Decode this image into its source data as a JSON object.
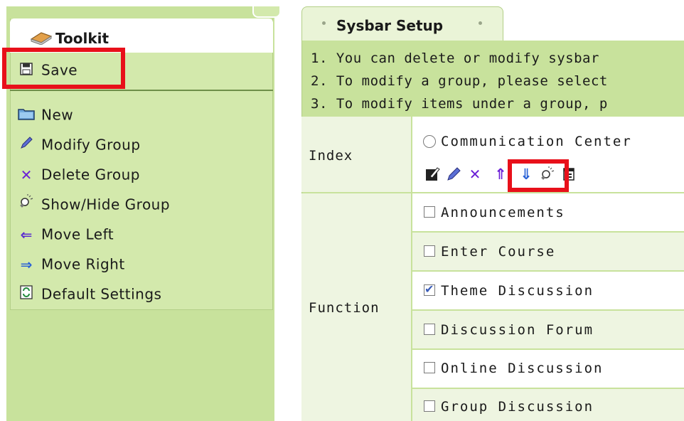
{
  "toolkit": {
    "title": "Toolkit",
    "items": [
      {
        "label": "Save",
        "icon": "floppy-disk-icon"
      },
      {
        "label": "New",
        "icon": "folder-icon"
      },
      {
        "label": "Modify Group",
        "icon": "pencil-icon"
      },
      {
        "label": "Delete Group",
        "icon": "delete-x-icon"
      },
      {
        "label": "Show/Hide Group",
        "icon": "lightbulb-icon"
      },
      {
        "label": "Move Left",
        "icon": "arrow-left-icon"
      },
      {
        "label": "Move Right",
        "icon": "arrow-right-icon"
      },
      {
        "label": "Default Settings",
        "icon": "refresh-icon"
      }
    ]
  },
  "setup": {
    "tab_title": "Sysbar Setup",
    "instructions": [
      "1. You can delete or modify sysbar",
      "2. To modify a group, please select",
      "3. To modify items under a group, p"
    ],
    "index_label": "Index",
    "group_name": "Communication Center",
    "function_label": "Function",
    "functions": [
      {
        "label": "Announcements",
        "checked": false
      },
      {
        "label": "Enter Course",
        "checked": false
      },
      {
        "label": "Theme Discussion",
        "checked": true
      },
      {
        "label": "Discussion Forum",
        "checked": false
      },
      {
        "label": "Online Discussion",
        "checked": false
      },
      {
        "label": "Group Discussion",
        "checked": false
      }
    ],
    "group_icons": [
      "edit-icon",
      "pencil-icon",
      "delete-x-icon",
      "arrow-up-icon",
      "arrow-down-icon",
      "lightbulb-icon",
      "add-item-icon"
    ]
  },
  "colors": {
    "panel_green": "#c8e29c",
    "light_green": "#eef5e1",
    "highlight_red": "#e8101a"
  }
}
